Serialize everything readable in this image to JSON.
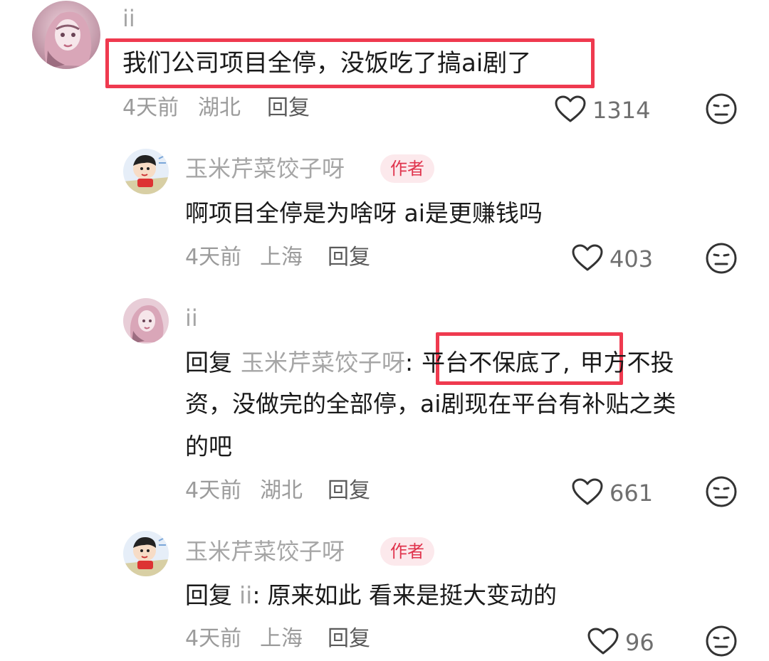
{
  "comments": [
    {
      "username": "ii",
      "text": "我们公司项目全停，没饭吃了搞ai剧了",
      "time": "4天前",
      "location": "湖北",
      "reply_label": "回复",
      "likes": "1314"
    }
  ],
  "replies": [
    {
      "username": "玉米芹菜饺子呀",
      "badge": "作者",
      "text": "啊项目全停是为啥呀 ai是更赚钱吗",
      "time": "4天前",
      "location": "上海",
      "reply_label": "回复",
      "likes": "403"
    },
    {
      "username": "ii",
      "reply_prefix": "回复",
      "reply_to": "玉米芹菜饺子呀",
      "colon": ":",
      "text_highlight": "平台不保底了,",
      "text_line1_rest": "甲方不投",
      "text_line2": "资，没做完的全部停，ai剧现在平台有补贴之类",
      "text_line3": "的吧",
      "time": "4天前",
      "location": "湖北",
      "reply_label": "回复",
      "likes": "661"
    },
    {
      "username": "玉米芹菜饺子呀",
      "badge": "作者",
      "reply_prefix": "回复",
      "reply_to": "ii",
      "colon": ":",
      "text": "原来如此 看来是挺大变动的",
      "time": "4天前",
      "location": "上海",
      "reply_label": "回复",
      "likes": "96"
    }
  ],
  "icons": {
    "like": "heart-outline-icon",
    "dislike": "meh-face-icon"
  },
  "colors": {
    "highlight_border": "#ef3a4f",
    "badge_bg": "#fce9ec",
    "badge_text": "#e0344d",
    "username": "#a6a6a6"
  }
}
